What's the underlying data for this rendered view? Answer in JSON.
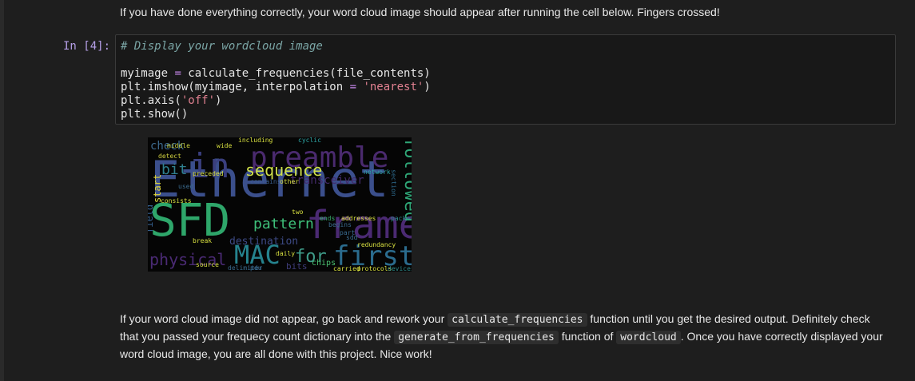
{
  "markdown_top": "If you have done everything correctly, your word cloud image should appear after running the cell below. Fingers crossed!",
  "cell": {
    "prompt": "In [4]:",
    "comment": "# Display your wordcloud image",
    "line2_a": "myimage ",
    "line2_op": "=",
    "line2_b": " calculate_frequencies(file_contents)",
    "line3_a": "plt.imshow(myimage, interpolation ",
    "line3_op": "=",
    "line3_sp": " ",
    "line3_str": "'nearest'",
    "line3_b": ")",
    "line4_a": "plt.axis(",
    "line4_str": "'off'",
    "line4_b": ")",
    "line5": "plt.show()"
  },
  "wordcloud": {
    "words": [
      {
        "text": "Ethernet",
        "color": "#3b4f8c"
      },
      {
        "text": "preamble",
        "color": "#4a2a6e"
      },
      {
        "text": "SFD",
        "color": "#2ea66a"
      },
      {
        "text": "frame",
        "color": "#4b2a73"
      },
      {
        "text": "followed",
        "color": "#2fa677"
      },
      {
        "text": "sequence",
        "color": "#cfe04a"
      },
      {
        "text": "in",
        "color": "#3a3f7e"
      },
      {
        "text": "bit",
        "color": "#2e7f8e"
      },
      {
        "text": "MAC",
        "color": "#25838e"
      },
      {
        "text": "first",
        "color": "#2b6c8e"
      },
      {
        "text": "physical",
        "color": "#4a2a74"
      },
      {
        "text": "for",
        "color": "#3e9a88"
      },
      {
        "text": "pattern",
        "color": "#3ec07a"
      },
      {
        "text": "destination",
        "color": "#3d4a85"
      },
      {
        "text": "transceiver",
        "color": "#432a6a"
      },
      {
        "text": "check",
        "color": "#3d6a8e"
      },
      {
        "text": "field",
        "color": "#355f8d"
      },
      {
        "text": "start",
        "color": "#ddd43a"
      },
      {
        "text": "bits",
        "color": "#3e3d7a"
      },
      {
        "text": "chips",
        "color": "#4ac070"
      },
      {
        "text": "carried",
        "color": "#d8e040"
      },
      {
        "text": "protocols",
        "color": "#d8e040"
      },
      {
        "text": "devices",
        "color": "#2e8c8c"
      },
      {
        "text": "pdu",
        "color": "#3a6a8e"
      },
      {
        "text": "sdd",
        "color": "#3a6a8e"
      },
      {
        "text": "packet",
        "color": "#2e8c8c"
      },
      {
        "text": "ends",
        "color": "#3ab070"
      },
      {
        "text": "addresses",
        "color": "#d8e040"
      },
      {
        "text": "section",
        "color": "#2e6a8e"
      },
      {
        "text": "network",
        "color": "#2ea6a6"
      },
      {
        "text": "middle",
        "color": "#c8d040"
      },
      {
        "text": "wide",
        "color": "#d8e040"
      },
      {
        "text": "including",
        "color": "#d8e040"
      },
      {
        "text": "cyclic",
        "color": "#2ea6a6"
      },
      {
        "text": "detect",
        "color": "#d0d040"
      },
      {
        "text": "preceded",
        "color": "#d8e040"
      },
      {
        "text": "consists",
        "color": "#d8e040"
      },
      {
        "text": "contains",
        "color": "#3a5e8e"
      },
      {
        "text": "other",
        "color": "#d8e040"
      },
      {
        "text": "two",
        "color": "#d8e040"
      },
      {
        "text": "part",
        "color": "#3a6a8e"
      },
      {
        "text": "redundancy",
        "color": "#d8e040"
      },
      {
        "text": "daily",
        "color": "#d8e040"
      },
      {
        "text": "source",
        "color": "#d8e040"
      },
      {
        "text": "delimiter",
        "color": "#3a6a8e"
      },
      {
        "text": "break",
        "color": "#d8e040"
      },
      {
        "text": "begins",
        "color": "#3a6a8e"
      },
      {
        "text": "used",
        "color": "#3a6a8e"
      }
    ]
  },
  "markdown_bottom": {
    "p1": "If your word cloud image did not appear, go back and rework your ",
    "code1": "calculate_frequencies",
    "p2": " function until you get the desired output. Definitely check that you passed your frequecy count dictionary into the ",
    "code2": "generate_from_frequencies",
    "p3": " function of ",
    "code3": "wordcloud",
    "p4": ". Once you have correctly displayed your word cloud image, you are all done with this project. Nice work!"
  }
}
